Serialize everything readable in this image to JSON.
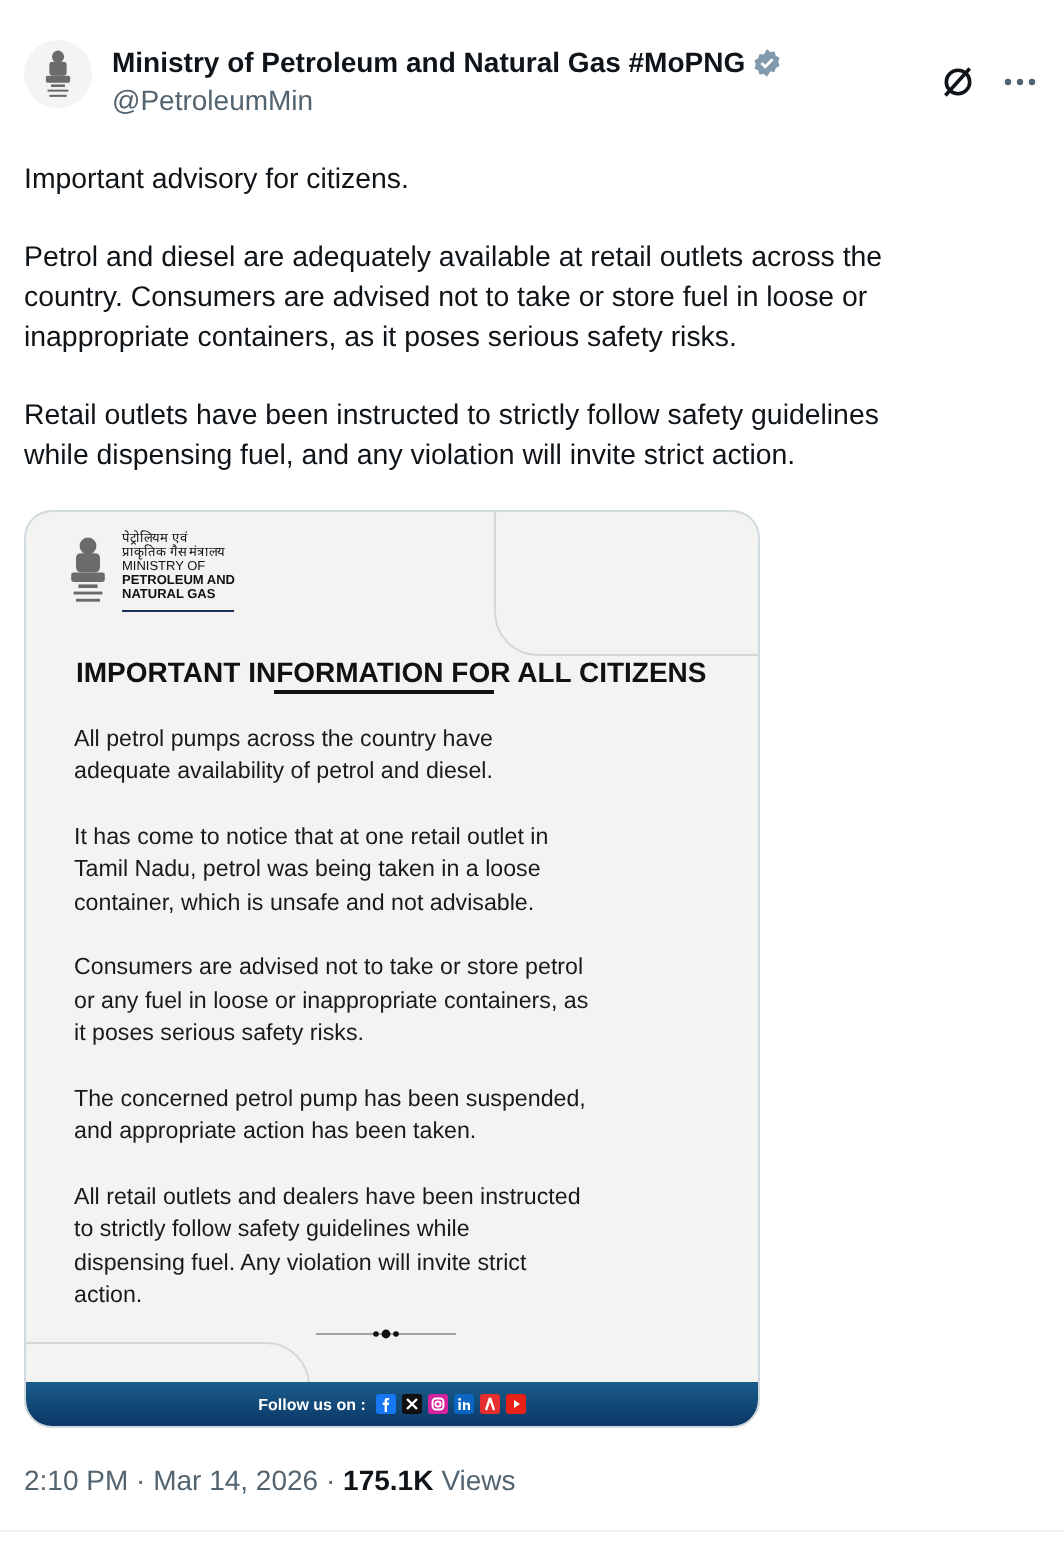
{
  "author": {
    "name": "Ministry of Petroleum and Natural Gas #MoPNG",
    "handle": "@PetroleumMin",
    "verified": true
  },
  "body": [
    "Important advisory for citizens.",
    "Petrol and diesel are adequately available at retail outlets across the\ncountry. Consumers are advised not to take or store fuel in loose or\ninappropriate containers, as it poses serious safety risks.",
    "Retail outlets have been instructed to strictly follow safety guidelines\nwhile dispensing fuel, and any violation will invite strict action."
  ],
  "poster": {
    "logo_lines": [
      "पेट्रोलियम एवं",
      "प्राकृतिक गैस मंत्रालय",
      "MINISTRY OF",
      "PETROLEUM AND",
      "NATURAL GAS"
    ],
    "heading": "IMPORTANT INFORMATION FOR ALL CITIZENS",
    "paragraphs": [
      "All petrol pumps across the country have\nadequate availability of petrol and diesel.",
      "It has come to notice that at one retail outlet in\nTamil Nadu, petrol was being taken in a loose\ncontainer, which is unsafe and not advisable.",
      "Consumers are advised not to take or store petrol\nor any fuel in loose or inappropriate containers, as\nit poses serious safety risks.",
      "The concerned petrol pump has been suspended,\nand appropriate action has been taken.",
      "All retail outlets and dealers have been instructed\nto strictly follow safety guidelines while\ndispensing fuel. Any violation will invite strict\naction."
    ],
    "footer": "Follow us on :"
  },
  "meta": {
    "time": "2:10 PM · Mar 14, 2026 · ",
    "views_count": "175.1K",
    "views_label": "Views"
  }
}
